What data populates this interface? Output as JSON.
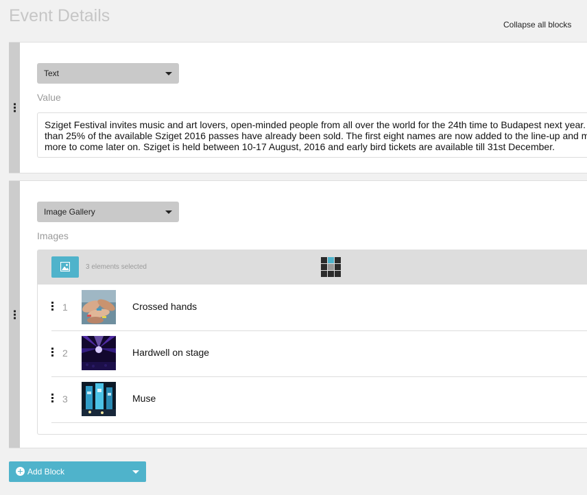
{
  "page": {
    "title": "Event Details",
    "collapse_label": "Collapse all blocks"
  },
  "text_block": {
    "type_label": "Text",
    "field_label": "Value",
    "value": "Sziget Festival invites music and art lovers, open-minded people from all over the world for the 24th time to Budapest next year. More\nthan 25% of the available Sziget 2016 passes have already been sold. The first eight names are now added to the line-up and more\nmore to come later on. Sziget is held between 10-17 August, 2016 and early bird tickets are available till 31st December."
  },
  "gallery_block": {
    "type_label": "Image Gallery",
    "field_label": "Images",
    "selected_count": "3 elements selected",
    "items": [
      {
        "index": "1",
        "title": "Crossed hands"
      },
      {
        "index": "2",
        "title": "Hardwell on stage"
      },
      {
        "index": "3",
        "title": "Muse"
      }
    ]
  },
  "add_block": {
    "label": "Add Block"
  },
  "colors": {
    "accent": "#4fb3cb",
    "handle": "#cccccc",
    "select_bg": "#c9c9c9"
  }
}
